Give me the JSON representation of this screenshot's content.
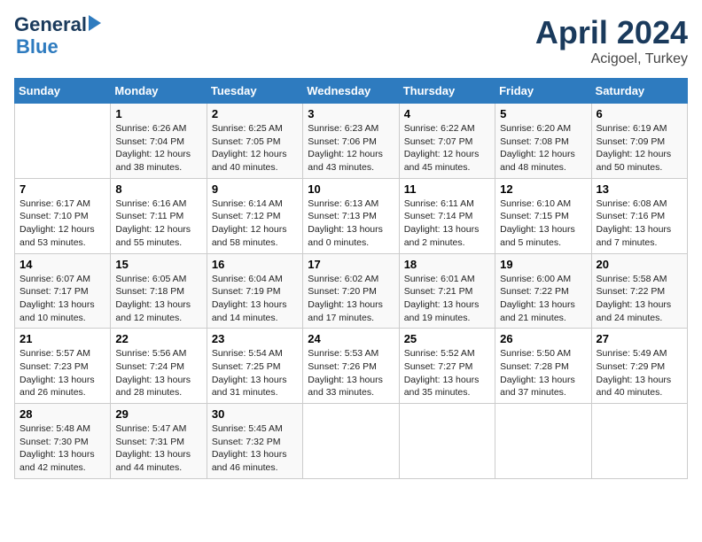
{
  "header": {
    "logo_line1": "General",
    "logo_line2": "Blue",
    "month": "April 2024",
    "location": "Acigoel, Turkey"
  },
  "days_of_week": [
    "Sunday",
    "Monday",
    "Tuesday",
    "Wednesday",
    "Thursday",
    "Friday",
    "Saturday"
  ],
  "weeks": [
    [
      {
        "num": "",
        "info": ""
      },
      {
        "num": "1",
        "info": "Sunrise: 6:26 AM\nSunset: 7:04 PM\nDaylight: 12 hours\nand 38 minutes."
      },
      {
        "num": "2",
        "info": "Sunrise: 6:25 AM\nSunset: 7:05 PM\nDaylight: 12 hours\nand 40 minutes."
      },
      {
        "num": "3",
        "info": "Sunrise: 6:23 AM\nSunset: 7:06 PM\nDaylight: 12 hours\nand 43 minutes."
      },
      {
        "num": "4",
        "info": "Sunrise: 6:22 AM\nSunset: 7:07 PM\nDaylight: 12 hours\nand 45 minutes."
      },
      {
        "num": "5",
        "info": "Sunrise: 6:20 AM\nSunset: 7:08 PM\nDaylight: 12 hours\nand 48 minutes."
      },
      {
        "num": "6",
        "info": "Sunrise: 6:19 AM\nSunset: 7:09 PM\nDaylight: 12 hours\nand 50 minutes."
      }
    ],
    [
      {
        "num": "7",
        "info": "Sunrise: 6:17 AM\nSunset: 7:10 PM\nDaylight: 12 hours\nand 53 minutes."
      },
      {
        "num": "8",
        "info": "Sunrise: 6:16 AM\nSunset: 7:11 PM\nDaylight: 12 hours\nand 55 minutes."
      },
      {
        "num": "9",
        "info": "Sunrise: 6:14 AM\nSunset: 7:12 PM\nDaylight: 12 hours\nand 58 minutes."
      },
      {
        "num": "10",
        "info": "Sunrise: 6:13 AM\nSunset: 7:13 PM\nDaylight: 13 hours\nand 0 minutes."
      },
      {
        "num": "11",
        "info": "Sunrise: 6:11 AM\nSunset: 7:14 PM\nDaylight: 13 hours\nand 2 minutes."
      },
      {
        "num": "12",
        "info": "Sunrise: 6:10 AM\nSunset: 7:15 PM\nDaylight: 13 hours\nand 5 minutes."
      },
      {
        "num": "13",
        "info": "Sunrise: 6:08 AM\nSunset: 7:16 PM\nDaylight: 13 hours\nand 7 minutes."
      }
    ],
    [
      {
        "num": "14",
        "info": "Sunrise: 6:07 AM\nSunset: 7:17 PM\nDaylight: 13 hours\nand 10 minutes."
      },
      {
        "num": "15",
        "info": "Sunrise: 6:05 AM\nSunset: 7:18 PM\nDaylight: 13 hours\nand 12 minutes."
      },
      {
        "num": "16",
        "info": "Sunrise: 6:04 AM\nSunset: 7:19 PM\nDaylight: 13 hours\nand 14 minutes."
      },
      {
        "num": "17",
        "info": "Sunrise: 6:02 AM\nSunset: 7:20 PM\nDaylight: 13 hours\nand 17 minutes."
      },
      {
        "num": "18",
        "info": "Sunrise: 6:01 AM\nSunset: 7:21 PM\nDaylight: 13 hours\nand 19 minutes."
      },
      {
        "num": "19",
        "info": "Sunrise: 6:00 AM\nSunset: 7:22 PM\nDaylight: 13 hours\nand 21 minutes."
      },
      {
        "num": "20",
        "info": "Sunrise: 5:58 AM\nSunset: 7:22 PM\nDaylight: 13 hours\nand 24 minutes."
      }
    ],
    [
      {
        "num": "21",
        "info": "Sunrise: 5:57 AM\nSunset: 7:23 PM\nDaylight: 13 hours\nand 26 minutes."
      },
      {
        "num": "22",
        "info": "Sunrise: 5:56 AM\nSunset: 7:24 PM\nDaylight: 13 hours\nand 28 minutes."
      },
      {
        "num": "23",
        "info": "Sunrise: 5:54 AM\nSunset: 7:25 PM\nDaylight: 13 hours\nand 31 minutes."
      },
      {
        "num": "24",
        "info": "Sunrise: 5:53 AM\nSunset: 7:26 PM\nDaylight: 13 hours\nand 33 minutes."
      },
      {
        "num": "25",
        "info": "Sunrise: 5:52 AM\nSunset: 7:27 PM\nDaylight: 13 hours\nand 35 minutes."
      },
      {
        "num": "26",
        "info": "Sunrise: 5:50 AM\nSunset: 7:28 PM\nDaylight: 13 hours\nand 37 minutes."
      },
      {
        "num": "27",
        "info": "Sunrise: 5:49 AM\nSunset: 7:29 PM\nDaylight: 13 hours\nand 40 minutes."
      }
    ],
    [
      {
        "num": "28",
        "info": "Sunrise: 5:48 AM\nSunset: 7:30 PM\nDaylight: 13 hours\nand 42 minutes."
      },
      {
        "num": "29",
        "info": "Sunrise: 5:47 AM\nSunset: 7:31 PM\nDaylight: 13 hours\nand 44 minutes."
      },
      {
        "num": "30",
        "info": "Sunrise: 5:45 AM\nSunset: 7:32 PM\nDaylight: 13 hours\nand 46 minutes."
      },
      {
        "num": "",
        "info": ""
      },
      {
        "num": "",
        "info": ""
      },
      {
        "num": "",
        "info": ""
      },
      {
        "num": "",
        "info": ""
      }
    ]
  ]
}
